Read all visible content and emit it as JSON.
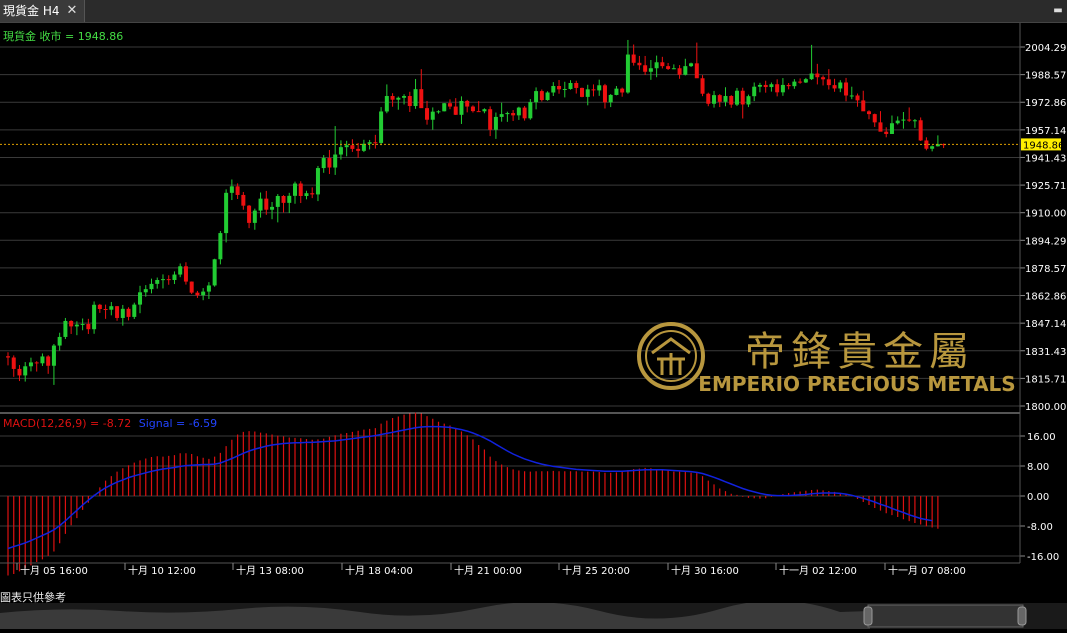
{
  "window": {
    "tab_title": "現貨金 H4",
    "close_glyph": "✕",
    "menu_glyph": "▬"
  },
  "price_panel": {
    "label": "現貨金 收市 = 1948.86",
    "current_price": 1948.86,
    "axis_ticks": [
      2004.29,
      1988.57,
      1972.86,
      1957.14,
      1941.43,
      1925.71,
      1910.0,
      1894.29,
      1878.57,
      1862.86,
      1847.14,
      1831.43,
      1815.71,
      1800.0
    ],
    "colors": {
      "up": "#22cc33",
      "down": "#ee1111",
      "price_line": "#e0a000",
      "price_tag_bg": "#ffee00",
      "grid": "#3a3a3a",
      "label": "#44dd44"
    }
  },
  "watermark": {
    "brand_cn": "帝鋒貴金屬",
    "brand_en": "EMPERIO PRECIOUS METALS",
    "color": "#b8973e"
  },
  "macd_panel": {
    "label_macd": "MACD(12,26,9) = -8.72",
    "label_signal": "Signal = -6.59",
    "axis_ticks": [
      "16.00",
      "8.00",
      "0.00",
      "-8.00",
      "-16.00"
    ],
    "colors": {
      "hist": "#dd1111",
      "signal": "#1122dd"
    }
  },
  "time_axis": {
    "labels": [
      "十月 05 16:00",
      "十月 10 12:00",
      "十月 13 08:00",
      "十月 18 04:00",
      "十月 21 00:00",
      "十月 25 20:00",
      "十月 30 16:00",
      "十一月 02 12:00",
      "十一月 07 08:00"
    ]
  },
  "footer": {
    "disclaimer": "圖表只供參考"
  },
  "chart_data": {
    "type": "candlestick",
    "price_ylim": [
      1800,
      2012
    ],
    "candles": [
      [
        1828.3,
        1830.6,
        1823.1,
        1827.6
      ],
      [
        1827.6,
        1828.8,
        1816.6,
        1821.1
      ],
      [
        1821.1,
        1823.3,
        1814.2,
        1817.4
      ],
      [
        1817.4,
        1825.0,
        1813.9,
        1822.6
      ],
      [
        1822.6,
        1827.5,
        1819.7,
        1824.8
      ],
      [
        1824.8,
        1825.5,
        1819.6,
        1824.3
      ],
      [
        1824.3,
        1829.9,
        1822.8,
        1828.2
      ],
      [
        1828.2,
        1828.9,
        1818.3,
        1822.9
      ],
      [
        1822.9,
        1835.3,
        1812.0,
        1834.4
      ],
      [
        1834.4,
        1841.7,
        1831.5,
        1839.3
      ],
      [
        1839.3,
        1850.1,
        1838.1,
        1848.4
      ],
      [
        1848.4,
        1848.8,
        1841.0,
        1845.3
      ],
      [
        1845.3,
        1848.2,
        1840.3,
        1846.3
      ],
      [
        1846.3,
        1849.8,
        1843.1,
        1846.7
      ],
      [
        1846.7,
        1849.6,
        1841.0,
        1843.7
      ],
      [
        1843.7,
        1859.5,
        1841.1,
        1857.6
      ],
      [
        1857.6,
        1858.1,
        1853.0,
        1855.2
      ],
      [
        1855.2,
        1857.7,
        1849.6,
        1854.8
      ],
      [
        1854.8,
        1859.2,
        1851.6,
        1856.8
      ],
      [
        1856.8,
        1856.9,
        1848.5,
        1850.1
      ],
      [
        1850.1,
        1857.5,
        1845.7,
        1855.3
      ],
      [
        1855.3,
        1856.2,
        1848.7,
        1850.7
      ],
      [
        1850.7,
        1858.8,
        1849.5,
        1857.7
      ],
      [
        1857.7,
        1868.4,
        1852.8,
        1864.7
      ],
      [
        1864.7,
        1868.8,
        1862.2,
        1866.5
      ],
      [
        1866.5,
        1872.5,
        1864.1,
        1869.5
      ],
      [
        1869.5,
        1873.1,
        1866.8,
        1871.7
      ],
      [
        1871.7,
        1874.9,
        1866.9,
        1872.2
      ],
      [
        1872.2,
        1874.4,
        1869.0,
        1871.7
      ],
      [
        1871.7,
        1876.6,
        1869.4,
        1874.8
      ],
      [
        1874.8,
        1881.1,
        1873.3,
        1879.5
      ],
      [
        1879.5,
        1881.8,
        1869.1,
        1870.8
      ],
      [
        1870.8,
        1870.9,
        1863.7,
        1864.5
      ],
      [
        1864.5,
        1865.5,
        1861.5,
        1863.0
      ],
      [
        1863.0,
        1867.1,
        1860.2,
        1865.1
      ],
      [
        1865.1,
        1870.5,
        1860.9,
        1868.6
      ],
      [
        1868.6,
        1883.8,
        1867.9,
        1883.5
      ],
      [
        1883.5,
        1899.6,
        1880.6,
        1898.4
      ],
      [
        1898.4,
        1923.3,
        1893.1,
        1921.3
      ],
      [
        1921.3,
        1928.9,
        1917.2,
        1925.0
      ],
      [
        1925.0,
        1926.7,
        1917.8,
        1920.1
      ],
      [
        1920.1,
        1921.8,
        1911.7,
        1914.0
      ],
      [
        1914.0,
        1914.4,
        1901.2,
        1904.2
      ],
      [
        1904.2,
        1912.3,
        1900.3,
        1911.2
      ],
      [
        1911.2,
        1921.5,
        1907.2,
        1918.0
      ],
      [
        1918.0,
        1922.4,
        1908.8,
        1911.7
      ],
      [
        1911.7,
        1916.1,
        1906.3,
        1913.3
      ],
      [
        1913.3,
        1920.6,
        1904.5,
        1919.5
      ],
      [
        1919.5,
        1920.0,
        1910.1,
        1915.6
      ],
      [
        1915.6,
        1921.3,
        1909.8,
        1919.6
      ],
      [
        1919.6,
        1927.7,
        1915.1,
        1926.6
      ],
      [
        1926.6,
        1927.9,
        1915.5,
        1919.5
      ],
      [
        1919.5,
        1922.5,
        1917.6,
        1921.1
      ],
      [
        1921.1,
        1924.4,
        1918.3,
        1920.4
      ],
      [
        1920.4,
        1936.6,
        1916.6,
        1935.4
      ],
      [
        1935.4,
        1942.8,
        1932.7,
        1941.1
      ],
      [
        1941.1,
        1945.7,
        1932.0,
        1935.7
      ],
      [
        1935.7,
        1959.3,
        1931.5,
        1943.1
      ],
      [
        1943.1,
        1951.2,
        1940.2,
        1947.3
      ],
      [
        1947.3,
        1950.9,
        1942.1,
        1948.4
      ],
      [
        1948.4,
        1951.8,
        1944.6,
        1946.3
      ],
      [
        1946.3,
        1949.7,
        1941.2,
        1945.2
      ],
      [
        1945.2,
        1951.5,
        1944.5,
        1949.2
      ],
      [
        1949.2,
        1951.4,
        1946.0,
        1950.1
      ],
      [
        1950.1,
        1954.3,
        1946.5,
        1949.7
      ],
      [
        1949.7,
        1970.1,
        1948.4,
        1967.6
      ],
      [
        1967.6,
        1983.0,
        1966.6,
        1976.4
      ],
      [
        1976.4,
        1978.0,
        1970.3,
        1974.3
      ],
      [
        1974.3,
        1976.1,
        1968.6,
        1975.4
      ],
      [
        1975.4,
        1977.4,
        1971.6,
        1976.4
      ],
      [
        1976.4,
        1978.8,
        1967.3,
        1970.7
      ],
      [
        1970.7,
        1986.1,
        1969.1,
        1980.3
      ],
      [
        1980.3,
        1991.7,
        1975.8,
        1969.5
      ],
      [
        1969.5,
        1973.6,
        1960.1,
        1962.9
      ],
      [
        1962.9,
        1969.9,
        1957.2,
        1967.5
      ],
      [
        1967.5,
        1968.3,
        1966.4,
        1967.7
      ],
      [
        1967.7,
        1972.4,
        1967.6,
        1972.3
      ],
      [
        1972.3,
        1974.5,
        1968.9,
        1970.4
      ],
      [
        1970.4,
        1975.2,
        1965.6,
        1965.7
      ],
      [
        1965.7,
        1976.2,
        1960.5,
        1973.6
      ],
      [
        1973.6,
        1974.2,
        1967.1,
        1970.4
      ],
      [
        1970.4,
        1971.1,
        1967.0,
        1967.8
      ],
      [
        1967.8,
        1973.5,
        1967.7,
        1967.7
      ],
      [
        1967.7,
        1969.4,
        1966.6,
        1968.9
      ],
      [
        1968.9,
        1970.5,
        1953.6,
        1957.2
      ],
      [
        1957.2,
        1967.0,
        1952.0,
        1964.5
      ],
      [
        1964.5,
        1972.6,
        1961.8,
        1966.1
      ],
      [
        1966.1,
        1967.5,
        1961.7,
        1966.7
      ],
      [
        1966.7,
        1968.4,
        1962.2,
        1965.4
      ],
      [
        1965.4,
        1970.3,
        1962.8,
        1969.8
      ],
      [
        1969.8,
        1970.7,
        1962.4,
        1963.7
      ],
      [
        1963.7,
        1974.7,
        1962.9,
        1972.9
      ],
      [
        1972.9,
        1981.3,
        1968.8,
        1979.2
      ],
      [
        1979.2,
        1980.1,
        1973.3,
        1974.1
      ],
      [
        1974.1,
        1979.1,
        1973.7,
        1978.4
      ],
      [
        1978.4,
        1984.3,
        1976.4,
        1982.1
      ],
      [
        1982.1,
        1985.5,
        1977.7,
        1980.2
      ],
      [
        1980.2,
        1984.5,
        1975.6,
        1980.4
      ],
      [
        1980.4,
        1985.4,
        1980.0,
        1983.8
      ],
      [
        1983.8,
        1985.1,
        1977.8,
        1981.0
      ],
      [
        1981.0,
        1981.2,
        1975.7,
        1975.9
      ],
      [
        1975.9,
        1982.8,
        1971.1,
        1980.2
      ],
      [
        1980.2,
        1983.0,
        1976.2,
        1979.6
      ],
      [
        1979.6,
        1985.7,
        1976.5,
        1982.5
      ],
      [
        1982.5,
        1983.3,
        1969.3,
        1972.8
      ],
      [
        1972.8,
        1977.5,
        1970.1,
        1977.0
      ],
      [
        1977.0,
        1982.1,
        1976.8,
        1980.6
      ],
      [
        1980.6,
        1981.2,
        1976.0,
        1978.4
      ],
      [
        1978.4,
        2008.3,
        1977.7,
        2000.0
      ],
      [
        2000.0,
        2005.7,
        1993.7,
        1995.3
      ],
      [
        1995.3,
        1999.2,
        1991.3,
        1993.9
      ],
      [
        1993.9,
        1999.2,
        1988.4,
        1990.2
      ],
      [
        1990.2,
        1996.9,
        1985.6,
        1992.2
      ],
      [
        1992.2,
        1999.4,
        1987.1,
        1995.6
      ],
      [
        1995.6,
        1998.7,
        1992.1,
        1993.4
      ],
      [
        1993.4,
        1995.2,
        1991.2,
        1991.8
      ],
      [
        1991.8,
        1994.4,
        1991.7,
        1992.2
      ],
      [
        1992.2,
        1994.0,
        1986.2,
        1988.5
      ],
      [
        1988.5,
        1997.6,
        1988.1,
        1993.4
      ],
      [
        1993.4,
        1995.4,
        1992.9,
        1995.0
      ],
      [
        1995.0,
        2006.8,
        1990.1,
        1986.5
      ],
      [
        1986.5,
        1988.3,
        1976.3,
        1977.7
      ],
      [
        1977.7,
        1978.3,
        1970.6,
        1972.0
      ],
      [
        1972.0,
        1979.3,
        1969.8,
        1976.9
      ],
      [
        1976.9,
        1977.5,
        1970.1,
        1973.1
      ],
      [
        1973.1,
        1981.4,
        1970.6,
        1976.4
      ],
      [
        1976.4,
        1976.9,
        1969.7,
        1971.5
      ],
      [
        1971.5,
        1981.0,
        1970.7,
        1979.4
      ],
      [
        1979.4,
        1981.1,
        1963.6,
        1971.6
      ],
      [
        1971.6,
        1977.2,
        1970.1,
        1976.3
      ],
      [
        1976.3,
        1984.1,
        1973.5,
        1981.7
      ],
      [
        1981.7,
        1983.9,
        1978.5,
        1982.7
      ],
      [
        1982.7,
        1985.1,
        1978.3,
        1981.5
      ],
      [
        1981.5,
        1984.1,
        1978.9,
        1983.1
      ],
      [
        1983.1,
        1985.9,
        1976.2,
        1978.5
      ],
      [
        1978.5,
        1986.6,
        1976.5,
        1982.7
      ],
      [
        1982.7,
        1983.8,
        1980.2,
        1982.0
      ],
      [
        1982.0,
        1986.0,
        1980.5,
        1984.6
      ],
      [
        1984.6,
        1986.4,
        1983.4,
        1984.1
      ],
      [
        1984.1,
        1986.7,
        1983.8,
        1986.0
      ],
      [
        1986.0,
        2005.5,
        1985.5,
        1989.2
      ],
      [
        1989.2,
        1994.7,
        1983.0,
        1987.1
      ],
      [
        1987.1,
        1988.1,
        1982.4,
        1985.9
      ],
      [
        1985.9,
        1991.7,
        1980.1,
        1982.6
      ],
      [
        1982.6,
        1986.2,
        1978.8,
        1980.7
      ],
      [
        1980.7,
        1985.4,
        1978.6,
        1984.1
      ],
      [
        1984.1,
        1986.7,
        1973.4,
        1976.7
      ],
      [
        1976.7,
        1981.7,
        1974.6,
        1976.7
      ],
      [
        1976.7,
        1977.8,
        1970.3,
        1973.9
      ],
      [
        1973.9,
        1979.4,
        1969.5,
        1967.7
      ],
      [
        1967.7,
        1968.3,
        1963.2,
        1966.1
      ],
      [
        1966.1,
        1966.4,
        1958.8,
        1961.4
      ],
      [
        1961.4,
        1967.8,
        1957.4,
        1956.1
      ],
      [
        1956.1,
        1958.6,
        1952.9,
        1954.8
      ],
      [
        1954.8,
        1965.3,
        1954.8,
        1960.9
      ],
      [
        1960.9,
        1964.8,
        1960.2,
        1962.4
      ],
      [
        1962.4,
        1967.3,
        1957.8,
        1963.0
      ],
      [
        1963.0,
        1969.9,
        1961.7,
        1962.4
      ],
      [
        1962.4,
        1963.3,
        1958.3,
        1962.6
      ],
      [
        1962.6,
        1964.2,
        1950.8,
        1951.1
      ],
      [
        1951.1,
        1952.9,
        1945.5,
        1946.4
      ],
      [
        1946.4,
        1948.3,
        1944.9,
        1947.8
      ],
      [
        1947.8,
        1954.0,
        1947.6,
        1949.0
      ],
      [
        1949.0,
        1949.4,
        1946.8,
        1948.86
      ]
    ],
    "macd": {
      "hist": [
        -21.2,
        -20.8,
        -20.1,
        -19.2,
        -18.5,
        -17.6,
        -16.9,
        -16.0,
        -14.8,
        -12.6,
        -10.1,
        -7.8,
        -5.9,
        -3.7,
        -1.8,
        0.4,
        2.3,
        4.1,
        5.3,
        6.5,
        7.4,
        8.2,
        8.9,
        9.5,
        10.0,
        10.4,
        10.6,
        10.5,
        10.7,
        10.9,
        11.4,
        11.4,
        11.2,
        10.6,
        10.2,
        9.9,
        10.5,
        11.5,
        13.3,
        15.0,
        16.4,
        17.1,
        17.3,
        17.2,
        16.9,
        16.7,
        16.4,
        16.1,
        15.9,
        15.6,
        15.5,
        15.4,
        15.2,
        15.0,
        15.1,
        15.3,
        15.8,
        16.2,
        16.6,
        16.8,
        17.1,
        17.4,
        17.7,
        17.9,
        18.1,
        19.3,
        20.1,
        20.8,
        21.2,
        21.7,
        22.0,
        22.2,
        22.0,
        21.3,
        20.6,
        19.8,
        19.3,
        18.8,
        17.9,
        17.2,
        16.2,
        15.1,
        13.6,
        12.4,
        10.5,
        9.3,
        8.4,
        7.7,
        7.1,
        6.8,
        6.6,
        6.5,
        6.6,
        6.6,
        6.6,
        6.7,
        6.6,
        6.6,
        6.6,
        6.6,
        6.5,
        6.5,
        6.5,
        6.4,
        6.2,
        6.2,
        6.3,
        6.5,
        6.9,
        7.2,
        7.3,
        7.5,
        7.4,
        7.2,
        7.1,
        6.8,
        6.5,
        6.5,
        6.4,
        6.2,
        6.1,
        5.3,
        4.1,
        3.1,
        2.0,
        1.3,
        0.6,
        0.3,
        -0.2,
        -0.5,
        -0.6,
        -0.7,
        -0.6,
        -0.2,
        0.1,
        0.5,
        0.8,
        1.0,
        1.2,
        1.4,
        1.6,
        1.7,
        1.5,
        1.3,
        1.1,
        0.8,
        0.4,
        -0.1,
        -0.8,
        -1.6,
        -2.4,
        -3.2,
        -3.9,
        -4.6,
        -5.1,
        -5.6,
        -6.2,
        -6.7,
        -7.2,
        -7.6,
        -8.1,
        -8.4,
        -8.72
      ],
      "signal": [
        -14.0,
        -13.5,
        -13.0,
        -12.5,
        -11.9,
        -11.2,
        -10.5,
        -9.8,
        -9.0,
        -7.9,
        -6.6,
        -5.2,
        -3.8,
        -2.4,
        -1.1,
        0.1,
        1.2,
        2.2,
        3.0,
        3.7,
        4.3,
        4.9,
        5.4,
        5.8,
        6.2,
        6.6,
        6.9,
        7.2,
        7.4,
        7.6,
        7.9,
        8.1,
        8.2,
        8.3,
        8.4,
        8.4,
        8.5,
        8.8,
        9.4,
        10.0,
        10.7,
        11.4,
        12.0,
        12.5,
        12.9,
        13.3,
        13.6,
        13.8,
        14.0,
        14.1,
        14.2,
        14.2,
        14.3,
        14.3,
        14.4,
        14.5,
        14.6,
        14.7,
        14.9,
        15.1,
        15.3,
        15.5,
        15.7,
        15.9,
        16.1,
        16.4,
        16.7,
        17.0,
        17.3,
        17.6,
        17.9,
        18.2,
        18.4,
        18.5,
        18.5,
        18.5,
        18.4,
        18.3,
        18.0,
        17.7,
        17.3,
        16.8,
        16.2,
        15.5,
        14.7,
        13.8,
        12.9,
        12.0,
        11.2,
        10.5,
        9.9,
        9.4,
        8.9,
        8.5,
        8.2,
        7.9,
        7.7,
        7.5,
        7.3,
        7.1,
        7.0,
        6.9,
        6.8,
        6.7,
        6.6,
        6.6,
        6.6,
        6.6,
        6.7,
        6.8,
        6.9,
        7.0,
        7.0,
        7.0,
        7.0,
        6.9,
        6.8,
        6.7,
        6.6,
        6.5,
        6.3,
        6.0,
        5.5,
        5.0,
        4.4,
        3.8,
        3.2,
        2.6,
        2.0,
        1.5,
        1.1,
        0.7,
        0.4,
        0.2,
        0.1,
        0.1,
        0.1,
        0.2,
        0.3,
        0.4,
        0.6,
        0.7,
        0.8,
        0.8,
        0.8,
        0.7,
        0.5,
        0.2,
        -0.2,
        -0.6,
        -1.1,
        -1.6,
        -2.2,
        -2.7,
        -3.3,
        -3.9,
        -4.4,
        -5.0,
        -5.5,
        -6.0,
        -6.3,
        -6.59
      ],
      "ylim": [
        -19.5,
        19.5
      ]
    },
    "xlabels": [
      "十月 05 16:00",
      "十月 10 12:00",
      "十月 13 08:00",
      "十月 18 04:00",
      "十月 21 00:00",
      "十月 25 20:00",
      "十月 30 16:00",
      "十一月 02 12:00",
      "十一月 07 08:00"
    ]
  }
}
